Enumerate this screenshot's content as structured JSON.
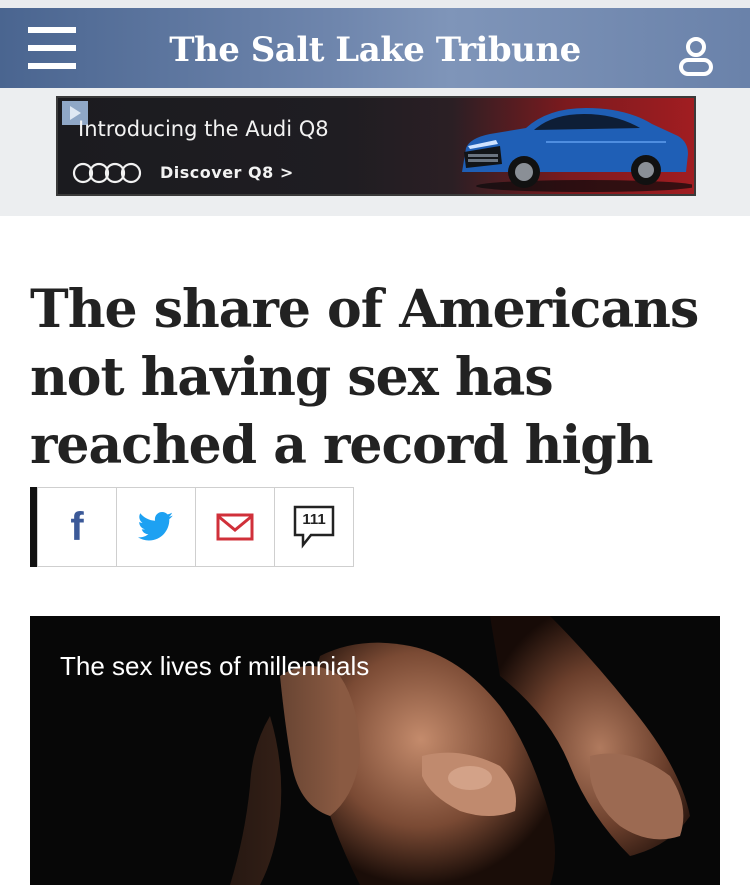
{
  "header": {
    "logo_text": "The Salt Lake Tribune",
    "menu_icon": "hamburger-menu-icon",
    "user_icon": "user-account-icon",
    "gradient_colors": [
      "#4a6590",
      "#7f95b9"
    ]
  },
  "ad": {
    "title": "Introducing the Audi Q8",
    "cta": "Discover Q8 >",
    "brand_icon": "audi-rings-icon",
    "badge_icon": "adchoices-icon"
  },
  "article": {
    "headline": "The share of Americans not having sex has reached a record high"
  },
  "share": {
    "facebook_icon": "facebook-icon",
    "twitter_icon": "twitter-icon",
    "email_icon": "email-icon",
    "comment_icon": "comment-icon",
    "comment_count": "111",
    "facebook_color": "#3b5998",
    "twitter_color": "#1da1f2",
    "email_color": "#d0303a"
  },
  "video": {
    "title": "The sex lives of millennials"
  }
}
